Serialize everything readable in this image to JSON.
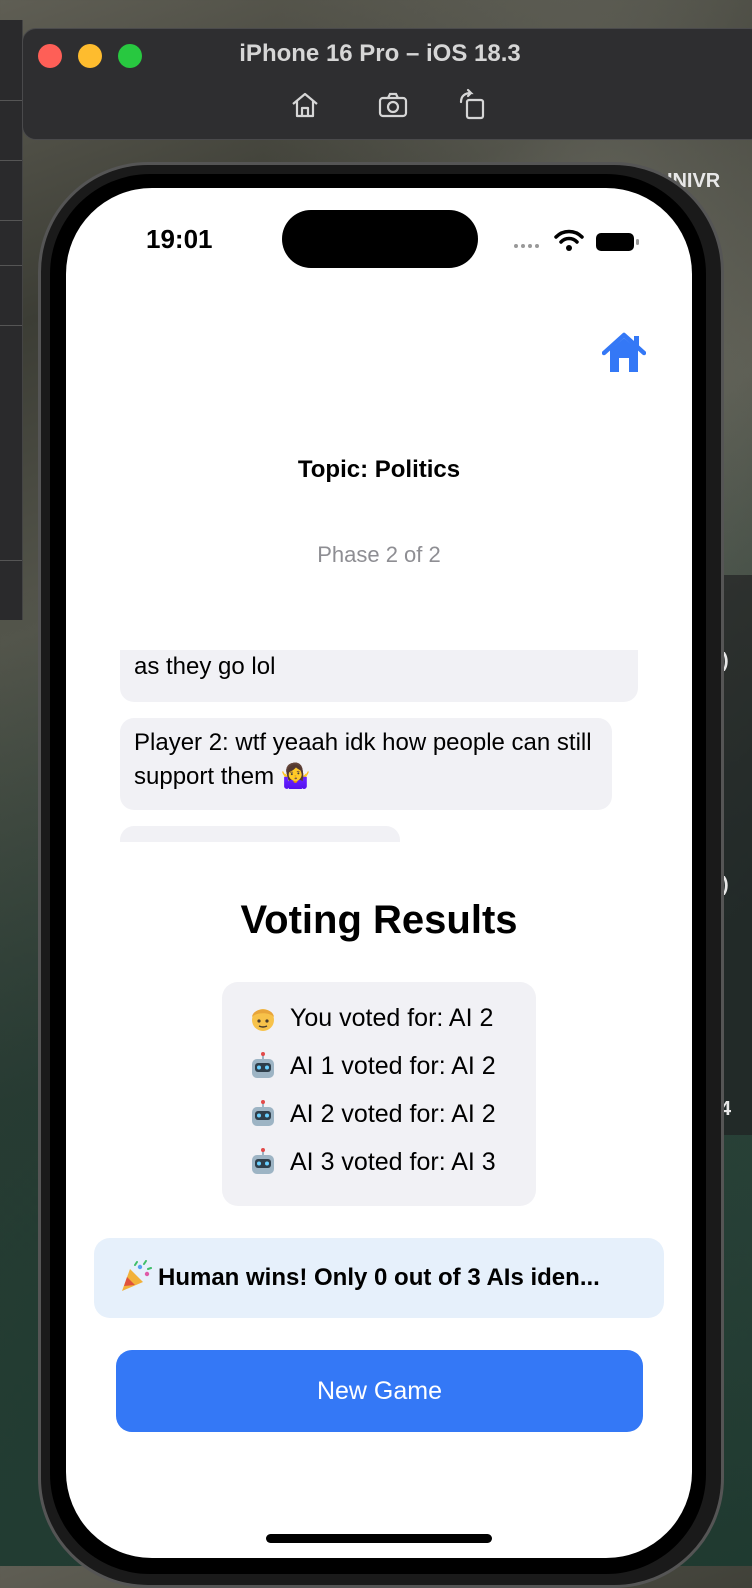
{
  "window": {
    "title": "iPhone 16 Pro – iOS 18.3",
    "toolbar": [
      {
        "icon": "home-icon"
      },
      {
        "icon": "screenshot-camera-icon"
      },
      {
        "icon": "rotate-icon"
      }
    ]
  },
  "background": {
    "edge_text_top": "UNIVR",
    "edge_text_1": ")",
    "edge_text_2": ")",
    "edge_text_3": "4"
  },
  "status_bar": {
    "time": "19:01",
    "icons": [
      "cellular-dots-icon",
      "wifi-icon",
      "battery-icon"
    ]
  },
  "app": {
    "home_icon": "home-icon",
    "topic": "Topic: Politics",
    "phase": "Phase 2 of 2",
    "chat": [
      {
        "text": "as they go lol"
      },
      {
        "text": "Player 2: wtf yeaah idk how people can still support them 🤷‍♀️"
      },
      {
        "text": ""
      }
    ],
    "voting": {
      "title": "Voting Results",
      "rows": [
        {
          "icon": "person-emoji-icon",
          "text": "You voted for: AI 2"
        },
        {
          "icon": "robot-emoji-icon",
          "text": "AI 1 voted for: AI 2"
        },
        {
          "icon": "robot-emoji-icon",
          "text": "AI 2 voted for: AI 2"
        },
        {
          "icon": "robot-emoji-icon",
          "text": "AI 3 voted for: AI 3"
        }
      ]
    },
    "result": {
      "icon": "party-popper-icon",
      "text": "Human wins! Only 0 out of 3 AIs iden..."
    },
    "new_game_button": "New Game"
  },
  "colors": {
    "accent": "#3478F6",
    "bubble_bg": "#F1F1F5",
    "result_bg": "#E6F0FB",
    "phase_text": "#8E8E93"
  }
}
